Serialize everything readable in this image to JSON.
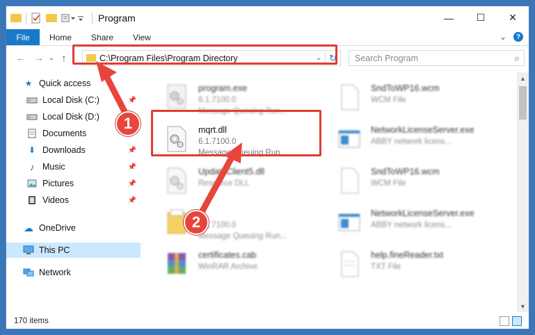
{
  "window": {
    "title": "Program",
    "controls": {
      "minimize": "—",
      "maximize": "☐",
      "close": "✕"
    }
  },
  "ribbon": {
    "tabs": [
      "File",
      "Home",
      "Share",
      "View"
    ],
    "expand_glyph": "⌄",
    "help_glyph": "?"
  },
  "nav": {
    "back": "←",
    "forward": "→",
    "recent": "⌄",
    "up": "↑",
    "address": "C:\\Program Files\\Program Directory",
    "address_dropdown": "⌄",
    "refresh": "↻",
    "search_placeholder": "Search Program",
    "search_glyph": "⌕"
  },
  "sidebar": {
    "items": [
      {
        "label": "Quick access",
        "icon": "star-icon",
        "glyph": "★",
        "color": "#1979ca",
        "pinned": false,
        "selected": false
      },
      {
        "label": "Local Disk (C:)",
        "icon": "drive-icon",
        "glyph": "▭",
        "color": "#444444",
        "pinned": true,
        "selected": false
      },
      {
        "label": "Local Disk (D:)",
        "icon": "drive-icon",
        "glyph": "▭",
        "color": "#444444",
        "pinned": true,
        "selected": false
      },
      {
        "label": "Documents",
        "icon": "documents-icon",
        "glyph": "▤",
        "color": "#555555",
        "pinned": true,
        "selected": false
      },
      {
        "label": "Downloads",
        "icon": "downloads-icon",
        "glyph": "⬇",
        "color": "#1979ca",
        "pinned": true,
        "selected": false
      },
      {
        "label": "Music",
        "icon": "music-icon",
        "glyph": "♪",
        "color": "#1979ca",
        "pinned": true,
        "selected": false
      },
      {
        "label": "Pictures",
        "icon": "pictures-icon",
        "glyph": "▨",
        "color": "#4a7fb5",
        "pinned": true,
        "selected": false
      },
      {
        "label": "Videos",
        "icon": "videos-icon",
        "glyph": "▦",
        "color": "#444444",
        "pinned": true,
        "selected": false
      },
      {
        "label": "OneDrive",
        "icon": "onedrive-icon",
        "glyph": "☁",
        "color": "#1979ca",
        "pinned": false,
        "selected": false
      },
      {
        "label": "This PC",
        "icon": "computer-icon",
        "glyph": "▭",
        "color": "#1979ca",
        "pinned": false,
        "selected": true
      },
      {
        "label": "Network",
        "icon": "network-icon",
        "glyph": "⊞",
        "color": "#1979ca",
        "pinned": false,
        "selected": false
      }
    ],
    "pin_glyph": "📌"
  },
  "files": [
    {
      "name": "program.exe",
      "line2": "6.1.7100.0",
      "line3": "Message Queuing Run...",
      "icon": "exe-gear-icon",
      "blurred": true
    },
    {
      "name": "SndToWP16.wcm",
      "line2": "WCM File",
      "line3": "",
      "icon": "blank-file-icon",
      "blurred": true
    },
    {
      "name": "mqrt.dll",
      "line2": "6.1.7100.0",
      "line3": "Message Queuing Run...",
      "icon": "dll-gear-icon",
      "blurred": false
    },
    {
      "name": "NetworkLicenseServer.exe",
      "line2": "ABBY network licens...",
      "line3": "",
      "icon": "window-exe-icon",
      "blurred": true
    },
    {
      "name": "UpdateClient5.dll",
      "line2": "Resource DLL",
      "line3": "",
      "icon": "dll-gear-icon",
      "blurred": true
    },
    {
      "name": "SndToWP16.wcm",
      "line2": "WCM File",
      "line3": "",
      "icon": "blank-file-icon",
      "blurred": true
    },
    {
      "name": "...",
      "line2": "6.1.7100.0",
      "line3": "Message Queuing Run...",
      "icon": "folder-file-icon",
      "blurred": true
    },
    {
      "name": "NetworkLicenseServer.exe",
      "line2": "ABBY network licens...",
      "line3": "",
      "icon": "window-exe-icon",
      "blurred": true
    },
    {
      "name": "certificates.cab",
      "line2": "WinRAR Archive",
      "line3": "",
      "icon": "archive-icon",
      "blurred": true
    },
    {
      "name": "help.fineReader.txt",
      "line2": "TXT File",
      "line3": "",
      "icon": "text-file-icon",
      "blurred": true
    }
  ],
  "status": {
    "count": "170 items"
  },
  "annotations": {
    "badge1": "1",
    "badge2": "2"
  },
  "colors": {
    "accent": "#1979ca",
    "highlight": "#e03c31",
    "selected": "#cce8ff"
  }
}
